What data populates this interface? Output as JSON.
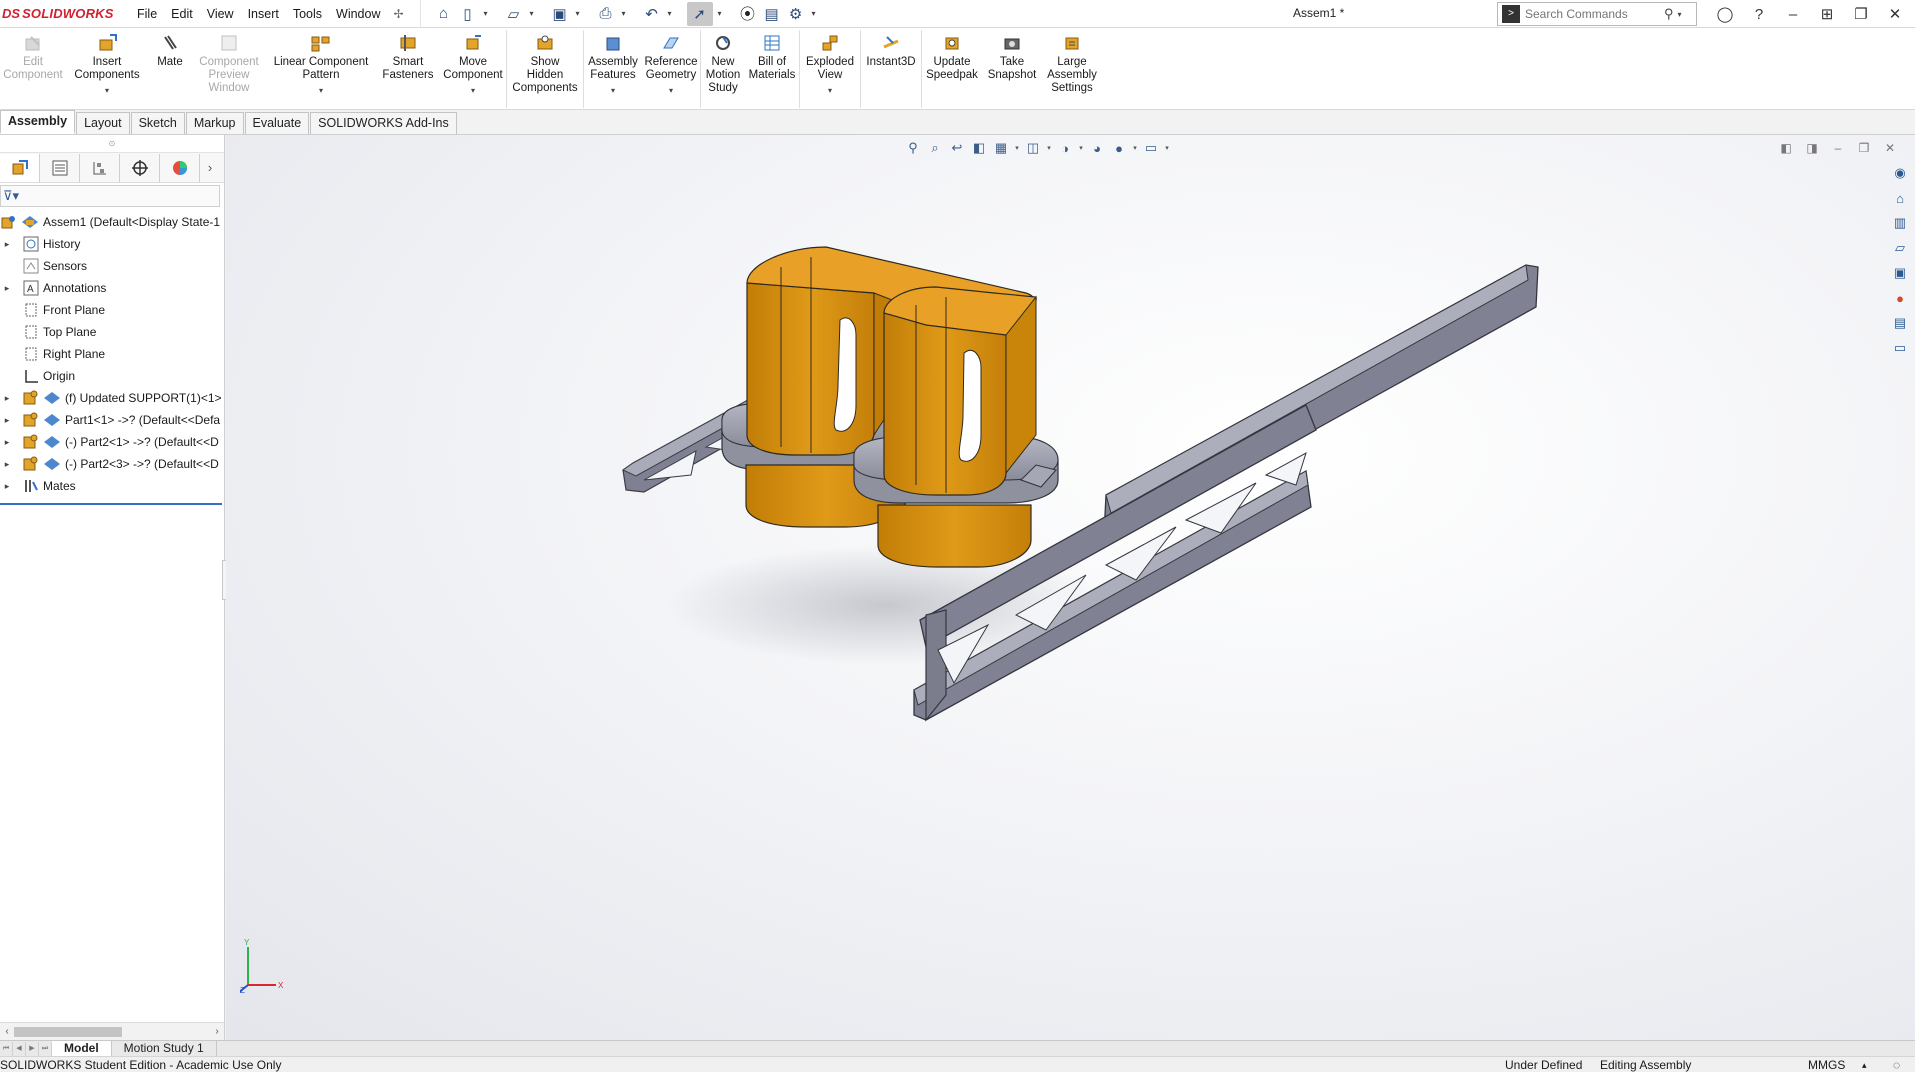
{
  "app": {
    "logo_ds": "DS",
    "logo_name": "SOLIDWORKS",
    "document_title": "Assem1 *",
    "menus": [
      "File",
      "Edit",
      "View",
      "Insert",
      "Tools",
      "Window"
    ],
    "search_placeholder": "Search Commands"
  },
  "ribbon": {
    "buttons": [
      {
        "label": "Edit\nComponent",
        "icon": "edit-component-icon",
        "disabled": true
      },
      {
        "label": "Insert\nComponents",
        "icon": "insert-components-icon",
        "disabled": false
      },
      {
        "label": "Mate",
        "icon": "mate-icon",
        "disabled": false
      },
      {
        "label": "Component\nPreview\nWindow",
        "icon": "component-preview-icon",
        "disabled": true
      },
      {
        "label": "Linear Component\nPattern",
        "icon": "linear-pattern-icon",
        "disabled": false
      },
      {
        "label": "Smart\nFasteners",
        "icon": "smart-fasteners-icon",
        "disabled": false
      },
      {
        "label": "Move\nComponent",
        "icon": "move-component-icon",
        "disabled": false
      },
      {
        "label": "Show\nHidden\nComponents",
        "icon": "show-hidden-icon",
        "disabled": false
      },
      {
        "label": "Assembly\nFeatures",
        "icon": "assembly-features-icon",
        "disabled": false
      },
      {
        "label": "Reference\nGeometry",
        "icon": "reference-geometry-icon",
        "disabled": false
      },
      {
        "label": "New\nMotion\nStudy",
        "icon": "motion-study-icon",
        "disabled": false
      },
      {
        "label": "Bill of\nMaterials",
        "icon": "bill-of-materials-icon",
        "disabled": false
      },
      {
        "label": "Exploded\nView",
        "icon": "exploded-view-icon",
        "disabled": false
      },
      {
        "label": "Instant3D",
        "icon": "instant3d-icon",
        "disabled": false
      },
      {
        "label": "Update\nSpeedpak",
        "icon": "speedpak-icon",
        "disabled": false
      },
      {
        "label": "Take\nSnapshot",
        "icon": "snapshot-icon",
        "disabled": false
      },
      {
        "label": "Large\nAssembly\nSettings",
        "icon": "large-assembly-icon",
        "disabled": false
      }
    ]
  },
  "command_tabs": [
    "Assembly",
    "Layout",
    "Sketch",
    "Markup",
    "Evaluate",
    "SOLIDWORKS Add-Ins"
  ],
  "feature_tree": {
    "root": "Assem1  (Default<Display State-1",
    "items": [
      {
        "label": "History",
        "icon": "history-icon",
        "expandable": true
      },
      {
        "label": "Sensors",
        "icon": "sensors-icon",
        "expandable": false
      },
      {
        "label": "Annotations",
        "icon": "annotations-icon",
        "expandable": true
      },
      {
        "label": "Front Plane",
        "icon": "plane-icon",
        "expandable": false
      },
      {
        "label": "Top Plane",
        "icon": "plane-icon",
        "expandable": false
      },
      {
        "label": "Right Plane",
        "icon": "plane-icon",
        "expandable": false
      },
      {
        "label": "Origin",
        "icon": "origin-icon",
        "expandable": false
      },
      {
        "label": "(f) Updated SUPPORT(1)<1>",
        "icon": "part-icon",
        "expandable": true
      },
      {
        "label": "Part1<1> ->? (Default<<Defa",
        "icon": "part-icon",
        "expandable": true
      },
      {
        "label": "(-) Part2<1> ->? (Default<<D",
        "icon": "part-icon",
        "expandable": true
      },
      {
        "label": "(-) Part2<3> ->? (Default<<D",
        "icon": "part-icon",
        "expandable": true
      },
      {
        "label": "Mates",
        "icon": "mates-icon",
        "expandable": true
      }
    ]
  },
  "bottom_tabs": [
    "Model",
    "Motion Study 1"
  ],
  "status": {
    "edition": "SOLIDWORKS Student Edition - Academic Use Only",
    "state": "Under Defined",
    "mode": "Editing Assembly",
    "units": "MMGS"
  },
  "triad": {
    "y": "Y",
    "x": "X",
    "z": "Z"
  },
  "colors": {
    "brand": "#d2202f",
    "part_orange": "#d9900e",
    "frame_gray": "#8e90a0",
    "selection_blue": "#2e73c6"
  }
}
